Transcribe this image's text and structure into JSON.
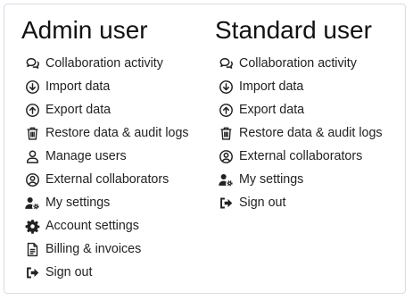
{
  "admin": {
    "title": "Admin user",
    "items": [
      {
        "icon": "comments-icon",
        "label": "Collaboration activity"
      },
      {
        "icon": "arrow-circle-down-icon",
        "label": "Import data"
      },
      {
        "icon": "arrow-circle-up-icon",
        "label": "Export data"
      },
      {
        "icon": "trash-icon",
        "label": "Restore data & audit logs"
      },
      {
        "icon": "user-icon",
        "label": "Manage users"
      },
      {
        "icon": "user-circle-icon",
        "label": "External collaborators"
      },
      {
        "icon": "user-gear-icon",
        "label": "My settings"
      },
      {
        "icon": "gear-icon",
        "label": "Account settings"
      },
      {
        "icon": "file-invoice-icon",
        "label": "Billing & invoices"
      },
      {
        "icon": "sign-out-icon",
        "label": "Sign out"
      }
    ]
  },
  "standard": {
    "title": "Standard user",
    "items": [
      {
        "icon": "comments-icon",
        "label": "Collaboration activity"
      },
      {
        "icon": "arrow-circle-down-icon",
        "label": "Import data"
      },
      {
        "icon": "arrow-circle-up-icon",
        "label": "Export data"
      },
      {
        "icon": "trash-icon",
        "label": "Restore data & audit logs"
      },
      {
        "icon": "user-circle-icon",
        "label": "External collaborators"
      },
      {
        "icon": "user-gear-icon",
        "label": "My settings"
      },
      {
        "icon": "sign-out-icon",
        "label": "Sign out"
      }
    ]
  },
  "colors": {
    "text": "#222222",
    "icon": "#222222",
    "border": "#d6dde5"
  }
}
